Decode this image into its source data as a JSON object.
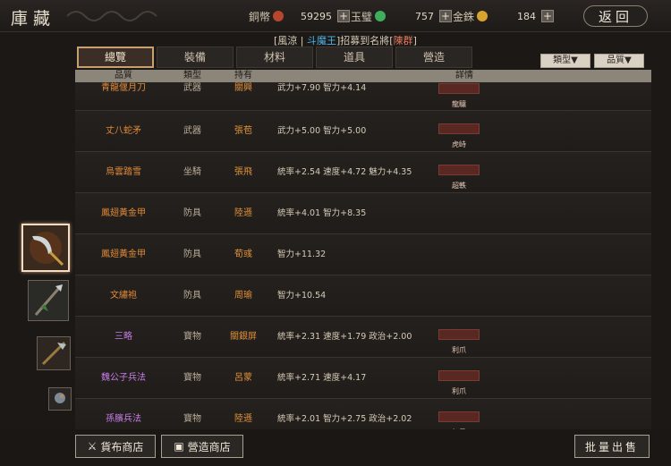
{
  "header": {
    "title": "庫藏",
    "back_label": "返回"
  },
  "currencies": [
    {
      "label": "銅幣",
      "value": "59295",
      "color": "#b8462e"
    },
    {
      "label": "玉璧",
      "value": "757",
      "color": "#3fae5c"
    },
    {
      "label": "金銖",
      "value": "184",
      "color": "#d8a430"
    }
  ],
  "recruit": {
    "prefix": "[風涼 | ",
    "user": "斗魔王",
    "middle": "]招募到名將[",
    "general": "陳群",
    "suffix": "]"
  },
  "tabs": [
    "總覽",
    "裝備",
    "材料",
    "道具",
    "營造"
  ],
  "active_tab": 0,
  "filters": [
    "類型▼",
    "品質▼"
  ],
  "columns": [
    "品質",
    "類型",
    "持有",
    "詳情"
  ],
  "rows": [
    {
      "name": "青龍偃月刀",
      "type": "武器",
      "owner": "關興",
      "detail": "武力+7.90  智力+4.14",
      "tag": "龍驤",
      "quality": "orange"
    },
    {
      "name": "丈八蛇矛",
      "type": "武器",
      "owner": "張苞",
      "detail": "武力+5.00  智力+5.00",
      "tag": "虎峙",
      "quality": "orange"
    },
    {
      "name": "烏雲踏雪",
      "type": "坐騎",
      "owner": "張飛",
      "detail": "統率+2.54  速度+4.72  魅力+4.35",
      "tag": "超軼",
      "quality": "orange"
    },
    {
      "name": "鳳翅黃金甲",
      "type": "防具",
      "owner": "陸遜",
      "detail": "統率+4.01  智力+8.35",
      "tag": "",
      "quality": "orange"
    },
    {
      "name": "鳳翅黃金甲",
      "type": "防具",
      "owner": "荀彧",
      "detail": "智力+11.32",
      "tag": "",
      "quality": "orange"
    },
    {
      "name": "文繡袍",
      "type": "防具",
      "owner": "周瑜",
      "detail": "智力+10.54",
      "tag": "",
      "quality": "orange"
    },
    {
      "name": "三略",
      "type": "寶物",
      "owner": "關銀屏",
      "detail": "統率+2.31  速度+1.79  政治+2.00",
      "tag": "利爪",
      "quality": "purple"
    },
    {
      "name": "魏公子兵法",
      "type": "寶物",
      "owner": "呂蒙",
      "detail": "統率+2.71  速度+4.17",
      "tag": "利爪",
      "quality": "purple"
    },
    {
      "name": "孫臏兵法",
      "type": "寶物",
      "owner": "陸遜",
      "detail": "統率+2.01  智力+2.75  政治+2.02",
      "tag": "無畏",
      "quality": "purple"
    }
  ],
  "bottom": {
    "shop_label": "貨布商店",
    "build_shop_label": "營造商店",
    "sell_label": "批量出售"
  }
}
